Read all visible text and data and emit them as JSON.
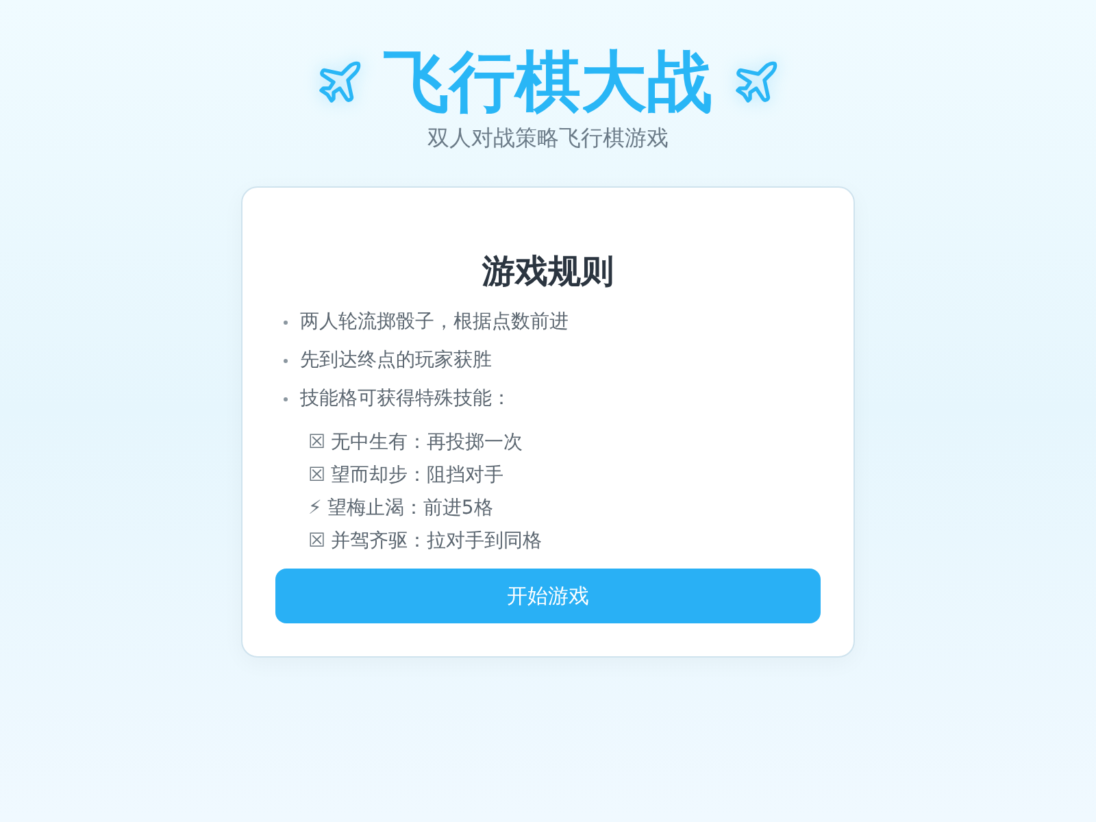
{
  "header": {
    "title": "飞行棋大战",
    "subtitle": "双人对战策略飞行棋游戏"
  },
  "rules_card": {
    "title": "游戏规则",
    "rules": [
      "两人轮流掷骰子，根据点数前进",
      "先到达终点的玩家获胜",
      "技能格可获得特殊技能："
    ],
    "skills": [
      {
        "icon": "☒",
        "text": "无中生有：再投掷一次"
      },
      {
        "icon": "☒",
        "text": "望而却步：阻挡对手"
      },
      {
        "icon": "⚡",
        "text": "望梅止渴：前进5格"
      },
      {
        "icon": "☒",
        "text": "并驾齐驱：拉对手到同格"
      }
    ],
    "start_button": "开始游戏"
  }
}
